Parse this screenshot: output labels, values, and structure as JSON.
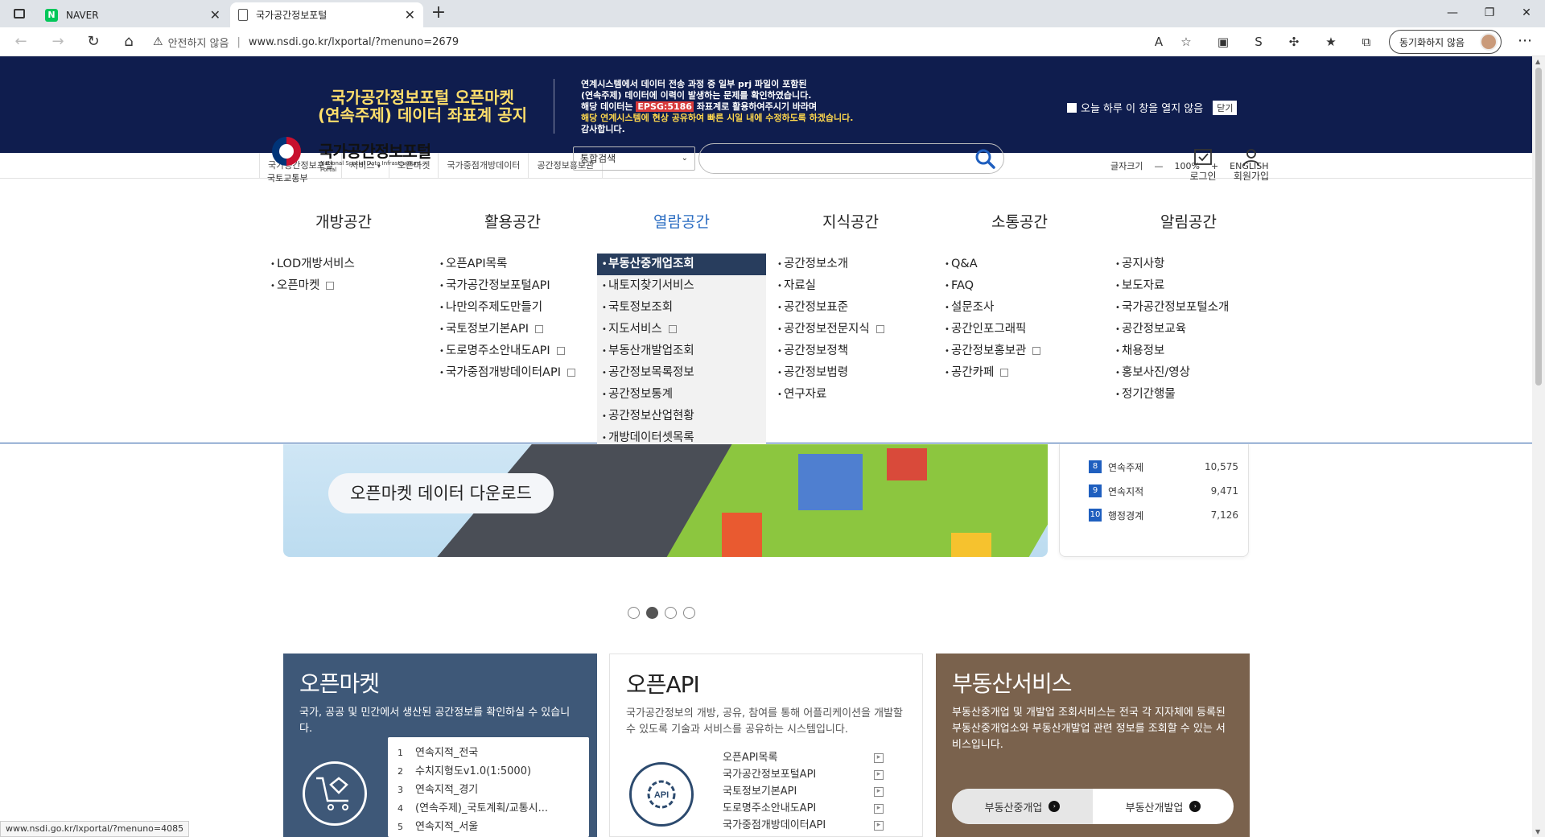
{
  "browser": {
    "tabs": [
      {
        "title": "NAVER",
        "favicon": "naver-icon"
      },
      {
        "title": "국가공간정보포털",
        "favicon": "page-icon"
      }
    ],
    "url": "www.nsdi.go.kr/lxportal/?menuno=2679",
    "security_label": "안전하지 않음",
    "sync_label": "동기화하지 않음",
    "status_url": "www.nsdi.go.kr/lxportal/?menuno=4085"
  },
  "notice": {
    "title_line1": "국가공간정보포털 오픈마켓",
    "title_line2": "(연속주제) 데이터 좌표계 공지",
    "body_line1": "연계시스템에서 데이터 전송 과정 중 일부 prj 파일이 포함된",
    "body_line2": "(연속주제) 데이터에 이력이 발생하는 문제를 확인하였습니다.",
    "body_line3_pre": "해당 데이터는",
    "body_line3_hl": "EPSG:5186",
    "body_line3_post": "좌표계로 활용하여주시기 바라며",
    "body_line4": "해당 연계시스템에 현상 공유하여 빠른 시일 내에 수정하도록 하겠습니다.",
    "body_line5": "감사합니다.",
    "dont_show_label": "오늘 하루 이 창을 열지 않음",
    "close_label": "닫기"
  },
  "utility": {
    "links": [
      "국가공간정보포털",
      "서비스",
      "오픈마켓",
      "국가중점개방데이터",
      "공간정보홍보관"
    ],
    "font_size_label": "글자크기",
    "zoom": "100%",
    "english": "ENGLISH"
  },
  "header": {
    "logo_name": "국가공간정보포털",
    "logo_en": "National Spatial Data Infrastructure Portal",
    "ministry": "국토교통부",
    "search_select": "통합검색",
    "login": "로그인",
    "signup": "회원가입"
  },
  "gnb": [
    "개방공간",
    "활용공간",
    "열람공간",
    "지식공간",
    "소통공간",
    "알림공간"
  ],
  "mega": {
    "col1": [
      "LOD개방서비스",
      "오픈마켓"
    ],
    "col2": [
      "오픈API목록",
      "국가공간정보포털API",
      "나만의주제도만들기",
      "국토정보기본API",
      "도로명주소안내도API",
      "국가중점개방데이터API"
    ],
    "col3": [
      "부동산중개업조회",
      "내토지찾기서비스",
      "국토정보조회",
      "지도서비스",
      "부동산개발업조회",
      "공간정보목록정보",
      "공간정보통계",
      "공간정보산업현황",
      "개방데이터셋목록"
    ],
    "col4": [
      "공간정보소개",
      "자료실",
      "공간정보표준",
      "공간정보전문지식",
      "공간정보정책",
      "공간정보법령",
      "연구자료"
    ],
    "col5": [
      "Q&A",
      "FAQ",
      "설문조사",
      "공간인포그래픽",
      "공간정보홍보관",
      "공간카페"
    ],
    "col6": [
      "공지사항",
      "보도자료",
      "국가공간정보포털소개",
      "공간정보교육",
      "채용정보",
      "홍보사진/영상",
      "정기간행물"
    ]
  },
  "banner": {
    "label": "오픈마켓 데이터 다운로드"
  },
  "ranking": [
    {
      "rank": "8",
      "name": "연속주제",
      "count": "10,575"
    },
    {
      "rank": "9",
      "name": "연속지적",
      "count": "9,471"
    },
    {
      "rank": "10",
      "name": "행정경계",
      "count": "7,126"
    }
  ],
  "cards": {
    "openmarket": {
      "title": "오픈마켓",
      "desc": "국가, 공공 및 민간에서 생산된 공간정보를 확인하실 수 있습니다.",
      "list": [
        "연속지적_전국",
        "수치지형도v1.0(1:5000)",
        "연속지적_경기",
        "(연속주제)_국토계획/교통시...",
        "연속지적_서울"
      ]
    },
    "openapi": {
      "title": "오픈API",
      "desc": "국가공간정보의 개방, 공유, 참여를 통해 어플리케이션을 개발할 수 있도록 기술과 서비스를 공유하는 시스템입니다.",
      "links": [
        "오픈API목록",
        "국가공간정보포털API",
        "국토정보기본API",
        "도로명주소안내도API",
        "국가중점개방데이터API"
      ]
    },
    "realestate": {
      "title": "부동산서비스",
      "desc": "부동산중개업 및 개발업 조회서비스는 전국 각 지자체에 등록된 부동산중개업소와 부동산개발업 관련 정보를 조회할 수 있는 서비스입니다.",
      "btn1": "부동산중개업",
      "btn2": "부동산개발업"
    }
  }
}
